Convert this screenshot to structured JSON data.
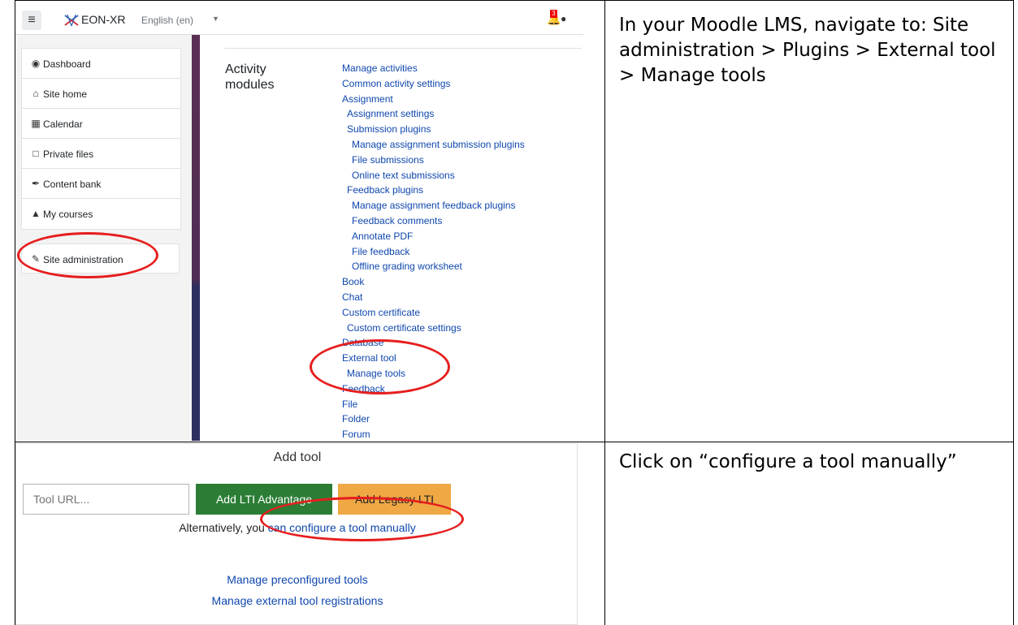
{
  "step1": {
    "navbar": {
      "menu_icon": "hamburger-icon",
      "site_name": "EON-XR",
      "language": "English (en)",
      "notification_count": "3"
    },
    "sidebar": {
      "items": [
        {
          "label": "Dashboard",
          "icon": "dashboard-icon"
        },
        {
          "label": "Site home",
          "icon": "home-icon"
        },
        {
          "label": "Calendar",
          "icon": "calendar-icon"
        },
        {
          "label": "Private files",
          "icon": "file-icon"
        },
        {
          "label": "Content bank",
          "icon": "paint-brush-icon"
        },
        {
          "label": "My courses",
          "icon": "graduation-cap-icon"
        }
      ],
      "admin": {
        "label": "Site administration",
        "icon": "wrench-icon"
      }
    },
    "section_label": "Activity modules",
    "links": [
      {
        "text": "Manage activities",
        "level": 1
      },
      {
        "text": "Common activity settings",
        "level": 1
      },
      {
        "text": "Assignment",
        "level": 1
      },
      {
        "text": "Assignment settings",
        "level": 2
      },
      {
        "text": "Submission plugins",
        "level": 2
      },
      {
        "text": "Manage assignment submission plugins",
        "level": 3
      },
      {
        "text": "File submissions",
        "level": 3
      },
      {
        "text": "Online text submissions",
        "level": 3
      },
      {
        "text": "Feedback plugins",
        "level": 2
      },
      {
        "text": "Manage assignment feedback plugins",
        "level": 3
      },
      {
        "text": "Feedback comments",
        "level": 3
      },
      {
        "text": "Annotate PDF",
        "level": 3
      },
      {
        "text": "File feedback",
        "level": 3
      },
      {
        "text": "Offline grading worksheet",
        "level": 3
      },
      {
        "text": "Book",
        "level": 1
      },
      {
        "text": "Chat",
        "level": 1
      },
      {
        "text": "Custom certificate",
        "level": 1
      },
      {
        "text": "Custom certificate settings",
        "level": 2
      },
      {
        "text": "Database",
        "level": 1
      },
      {
        "text": "External tool",
        "level": 1
      },
      {
        "text": "Manage tools",
        "level": 2
      },
      {
        "text": "Feedback",
        "level": 1
      },
      {
        "text": "File",
        "level": 1
      },
      {
        "text": "Folder",
        "level": 1
      },
      {
        "text": "Forum",
        "level": 1
      }
    ],
    "instruction": "In your Moodle LMS, navigate to: Site administration > Plugins > External tool > Manage tools"
  },
  "step2": {
    "title": "Add tool",
    "url_placeholder": "Tool URL...",
    "btn_advantage": "Add LTI Advantage",
    "btn_legacy": "Add Legacy LTI",
    "alt_prefix": "Alternatively, you ",
    "alt_link": "can configure a tool manually",
    "link_preconfigured": "Manage preconfigured tools",
    "link_registrations": "Manage external tool registrations",
    "instruction": "Click on “configure a tool manually”"
  },
  "colors": {
    "annotation": "#e61e1e",
    "link": "#0f47ad",
    "btn_advantage": "#2b7d35",
    "btn_legacy": "#f0a844"
  }
}
